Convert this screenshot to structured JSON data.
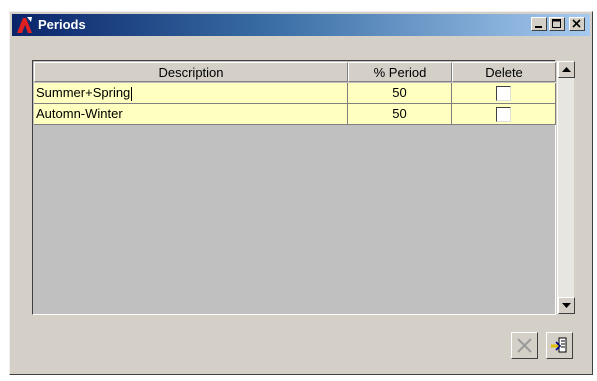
{
  "window": {
    "title": "Periods",
    "icon": "app-logo-icon"
  },
  "titlebar_buttons": [
    {
      "name": "minimize",
      "icon": "minimize-icon"
    },
    {
      "name": "maximize",
      "icon": "maximize-icon"
    },
    {
      "name": "close",
      "icon": "close-icon"
    }
  ],
  "grid": {
    "columns": [
      "Description",
      "% Period",
      "Delete"
    ],
    "rows": [
      {
        "description": "Summer+Spring",
        "period": "50",
        "delete": false
      },
      {
        "description": "Automn-Winter",
        "period": "50",
        "delete": false
      }
    ]
  },
  "toolbar": {
    "delete_icon": "delete-x-icon",
    "exit_icon": "exit-door-icon"
  },
  "colors": {
    "row_bg": "#ffffc0",
    "grid_bg": "#c0c0c0",
    "title_start": "#0a246a",
    "title_end": "#a6caf0"
  }
}
